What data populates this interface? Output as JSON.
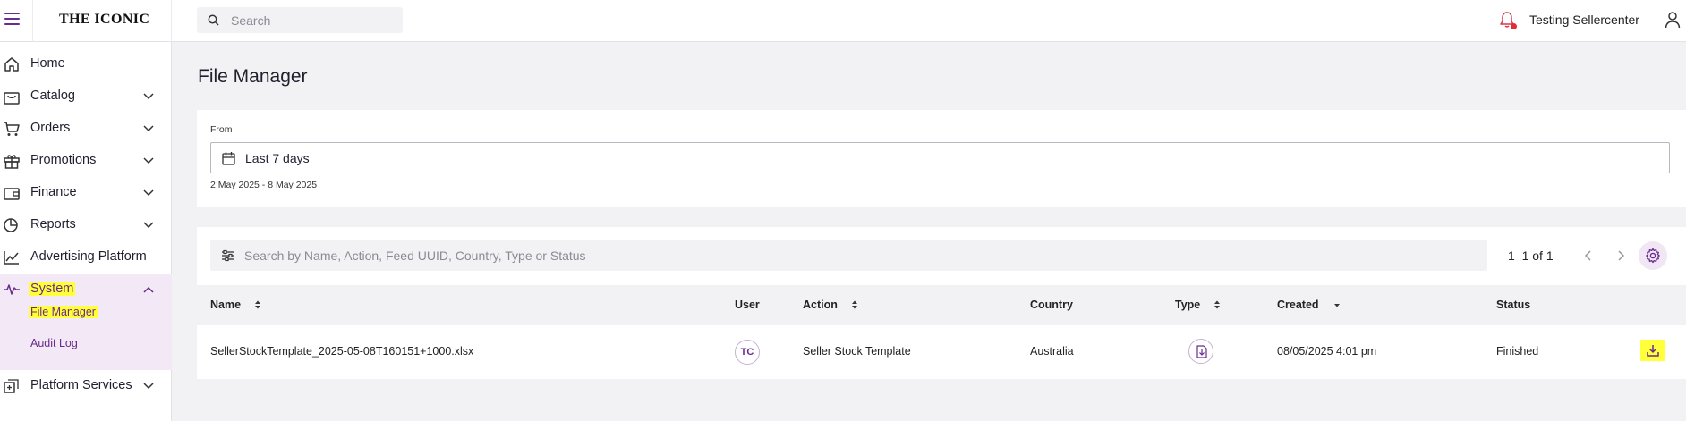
{
  "header": {
    "logo": "THE ICONIC",
    "search_placeholder": "Search",
    "username": "Testing Sellercenter"
  },
  "sidebar": {
    "items": [
      {
        "label": "Home"
      },
      {
        "label": "Catalog"
      },
      {
        "label": "Orders"
      },
      {
        "label": "Promotions"
      },
      {
        "label": "Finance"
      },
      {
        "label": "Reports"
      },
      {
        "label": "Advertising Platform"
      },
      {
        "label": "System"
      },
      {
        "label": "Platform Services"
      }
    ],
    "system_sub": [
      {
        "label": "File Manager"
      },
      {
        "label": "Audit Log"
      }
    ]
  },
  "page": {
    "title": "File Manager"
  },
  "filter": {
    "from_label": "From",
    "value": "Last 7 days",
    "range": "2 May 2025 - 8 May 2025"
  },
  "table": {
    "search_placeholder": "Search by Name, Action, Feed UUID, Country, Type or Status",
    "pagination": "1–1 of 1",
    "columns": [
      "Name",
      "User",
      "Action",
      "Country",
      "Type",
      "Created",
      "Status"
    ],
    "rows": [
      {
        "name": "SellerStockTemplate_2025-05-08T160151+1000.xlsx",
        "user": "TC",
        "action": "Seller Stock Template",
        "country": "Australia",
        "created": "08/05/2025 4:01 pm",
        "status": "Finished"
      }
    ]
  },
  "colors": {
    "accent": "#6a2b8c",
    "highlight": "#ffff3a",
    "notification": "#e52a3a"
  }
}
